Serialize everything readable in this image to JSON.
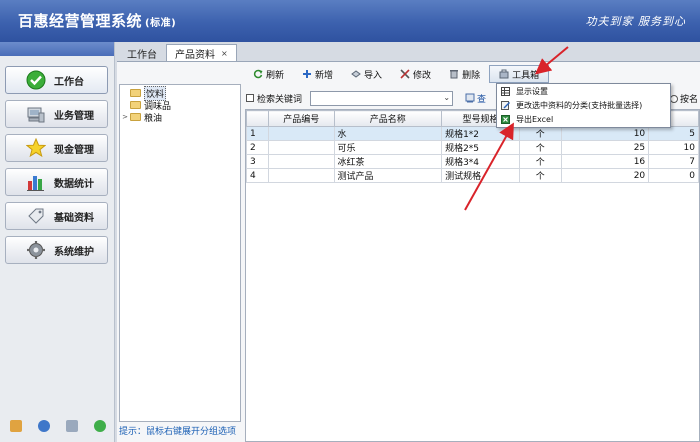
{
  "header": {
    "title": "百惠经营管理系统",
    "edition": "(标准)",
    "slogan": "功夫到家 服务到心"
  },
  "sidebar": {
    "items": [
      {
        "label": "工作台",
        "icon": "check-circle-icon",
        "active": true
      },
      {
        "label": "业务管理",
        "icon": "computer-icon",
        "active": false
      },
      {
        "label": "现金管理",
        "icon": "star-icon",
        "active": false
      },
      {
        "label": "数据统计",
        "icon": "bar-chart-icon",
        "active": false
      },
      {
        "label": "基础资料",
        "icon": "tag-icon",
        "active": false
      },
      {
        "label": "系统维护",
        "icon": "gear-icon",
        "active": false
      }
    ]
  },
  "tabs": [
    {
      "label": "工作台"
    },
    {
      "label": "产品资料",
      "close": "×"
    }
  ],
  "toolbar": {
    "refresh": "刷新",
    "add": "新增",
    "import": "导入",
    "edit": "修改",
    "delete": "删除",
    "toolbox": "工具箱"
  },
  "tree": {
    "nodes": [
      {
        "label": "饮料",
        "selected": true
      },
      {
        "label": "调味品",
        "selected": false
      },
      {
        "label": "粮油",
        "selected": false,
        "expander": ">"
      }
    ],
    "hint": "提示：鼠标右键展开分组选项"
  },
  "search": {
    "checkbox_label": "检索关键词",
    "combo_value": "",
    "search_button": "查",
    "radio_label": "按名"
  },
  "grid": {
    "columns": [
      "",
      "产品编号",
      "产品名称",
      "型号规格",
      "",
      "",
      ""
    ],
    "rows": [
      {
        "idx": "1",
        "code": "",
        "name": "水",
        "spec": "规格1*2",
        "unit": "个",
        "qty": "10",
        "price": "5"
      },
      {
        "idx": "2",
        "code": "",
        "name": "可乐",
        "spec": "规格2*5",
        "unit": "个",
        "qty": "25",
        "price": "10"
      },
      {
        "idx": "3",
        "code": "",
        "name": "冰红茶",
        "spec": "规格3*4",
        "unit": "个",
        "qty": "16",
        "price": "7"
      },
      {
        "idx": "4",
        "code": "",
        "name": "测试产品",
        "spec": "测试规格",
        "unit": "个",
        "qty": "20",
        "price": "0"
      }
    ]
  },
  "toolbox_menu": {
    "items": [
      {
        "label": "显示设置",
        "icon": "grid-icon"
      },
      {
        "label": "更改选中资料的分类(支持批量选择)",
        "icon": "edit-doc-icon"
      },
      {
        "label": "导出Excel",
        "icon": "excel-icon"
      }
    ]
  },
  "colors": {
    "header": "#3c61ae",
    "arrow": "#d9232a",
    "selection": "#d9e9f7",
    "link": "#1a5fb4"
  }
}
